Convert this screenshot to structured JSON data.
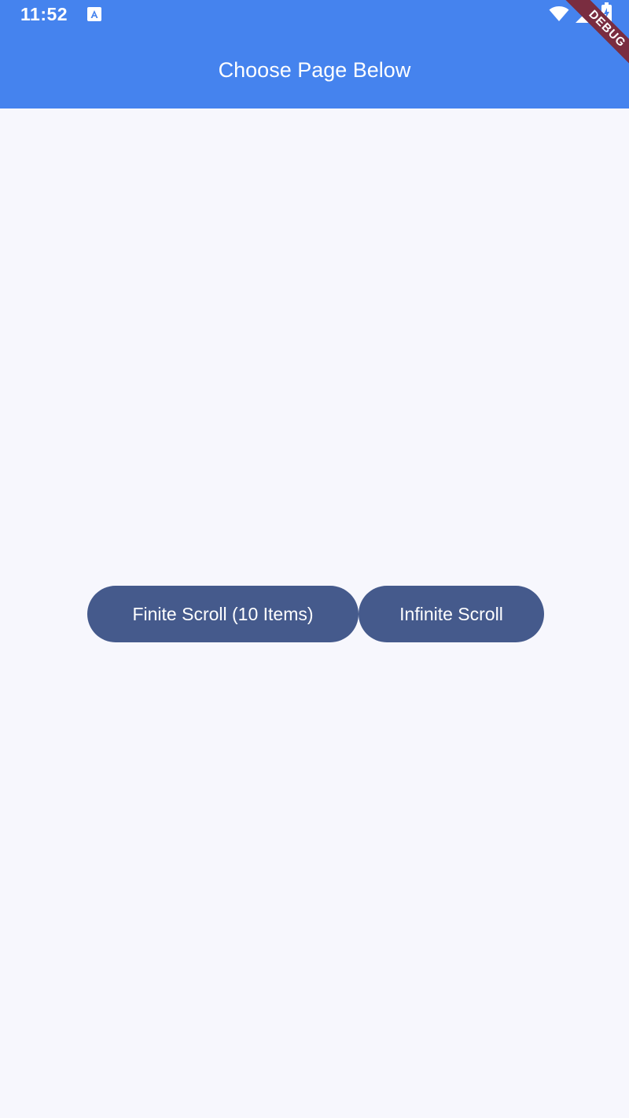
{
  "status_bar": {
    "time": "11:52",
    "notification_icon": "a-icon",
    "wifi_icon": "wifi-icon",
    "signal_icon": "signal-icon",
    "battery_icon": "battery-charging-icon"
  },
  "debug_banner": {
    "label": "DEBUG",
    "color": "#7a2d40"
  },
  "app_bar": {
    "title": "Choose Page Below",
    "color": "#4583ee"
  },
  "buttons": {
    "finite_label": "Finite Scroll (10 Items)",
    "infinite_label": "Infinite Scroll",
    "color": "#455a8c"
  },
  "background_color": "#f7f7fd"
}
